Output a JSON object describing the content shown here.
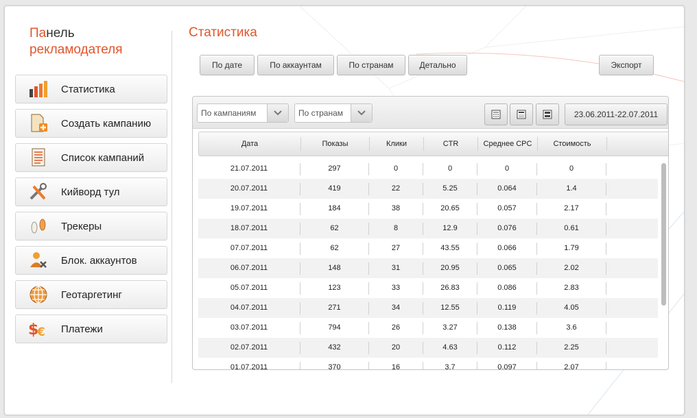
{
  "sidebar": {
    "title_accent": "Па",
    "title_rest": "нель",
    "title_line2": "рекламодателя",
    "items": [
      {
        "label": "Статистика",
        "icon": "bar-chart-icon"
      },
      {
        "label": "Создать кампанию",
        "icon": "new-document-icon"
      },
      {
        "label": "Список кампаний",
        "icon": "document-list-icon"
      },
      {
        "label": "Кийворд тул",
        "icon": "tools-icon"
      },
      {
        "label": "Трекеры",
        "icon": "footprints-icon"
      },
      {
        "label": "Блок. аккаунтов",
        "icon": "user-block-icon"
      },
      {
        "label": "Геотаргетинг",
        "icon": "globe-icon"
      },
      {
        "label": "Платежи",
        "icon": "money-icon"
      }
    ]
  },
  "main": {
    "title": "Статистика",
    "tabs": [
      "По дате",
      "По аккаунтам",
      "По странам",
      "Детально"
    ],
    "export_label": "Экспорт"
  },
  "filters": {
    "campaign_select": "По кампаниям",
    "country_select": "По странам",
    "date_range": "23.06.2011-22.07.2011"
  },
  "table": {
    "columns": [
      "Дата",
      "Показы",
      "Клики",
      "CTR",
      "Среднее CPC",
      "Стоимость"
    ],
    "rows": [
      [
        "21.07.2011",
        "297",
        "0",
        "0",
        "0",
        "0"
      ],
      [
        "20.07.2011",
        "419",
        "22",
        "5.25",
        "0.064",
        "1.4"
      ],
      [
        "19.07.2011",
        "184",
        "38",
        "20.65",
        "0.057",
        "2.17"
      ],
      [
        "18.07.2011",
        "62",
        "8",
        "12.9",
        "0.076",
        "0.61"
      ],
      [
        "07.07.2011",
        "62",
        "27",
        "43.55",
        "0.066",
        "1.79"
      ],
      [
        "06.07.2011",
        "148",
        "31",
        "20.95",
        "0.065",
        "2.02"
      ],
      [
        "05.07.2011",
        "123",
        "33",
        "26.83",
        "0.086",
        "2.83"
      ],
      [
        "04.07.2011",
        "271",
        "34",
        "12.55",
        "0.119",
        "4.05"
      ],
      [
        "03.07.2011",
        "794",
        "26",
        "3.27",
        "0.138",
        "3.6"
      ],
      [
        "02.07.2011",
        "432",
        "20",
        "4.63",
        "0.112",
        "2.25"
      ],
      [
        "01.07.2011",
        "370",
        "16",
        "3.7",
        "0.097",
        "2.07"
      ]
    ]
  },
  "colors": {
    "accent": "#e0562a"
  }
}
